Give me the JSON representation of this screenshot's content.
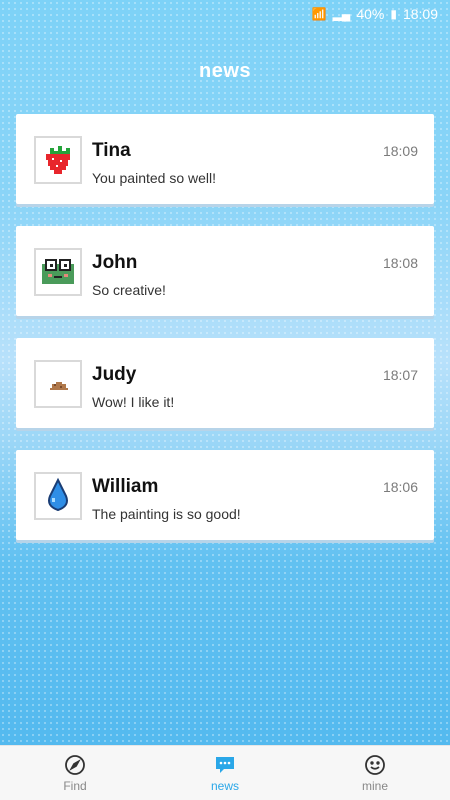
{
  "status_bar": {
    "battery": "40%",
    "time": "18:09"
  },
  "page": {
    "title": "news"
  },
  "messages": [
    {
      "name": "Tina",
      "time": "18:09",
      "text": "You painted so well!",
      "avatar_icon": "strawberry-icon"
    },
    {
      "name": "John",
      "time": "18:08",
      "text": "So creative!",
      "avatar_icon": "frog-icon"
    },
    {
      "name": "Judy",
      "time": "18:07",
      "text": "Wow! I like it!",
      "avatar_icon": "pile-icon"
    },
    {
      "name": "William",
      "time": "18:06",
      "text": "The painting is so good!",
      "avatar_icon": "water-drop-icon"
    }
  ],
  "tabbar": {
    "items": [
      {
        "label": "Find",
        "icon": "compass-icon"
      },
      {
        "label": "news",
        "icon": "chat-icon",
        "active": true
      },
      {
        "label": "mine",
        "icon": "smiley-icon"
      }
    ]
  },
  "colors": {
    "accent": "#2aa7e8",
    "background": "#6fc7f4"
  }
}
